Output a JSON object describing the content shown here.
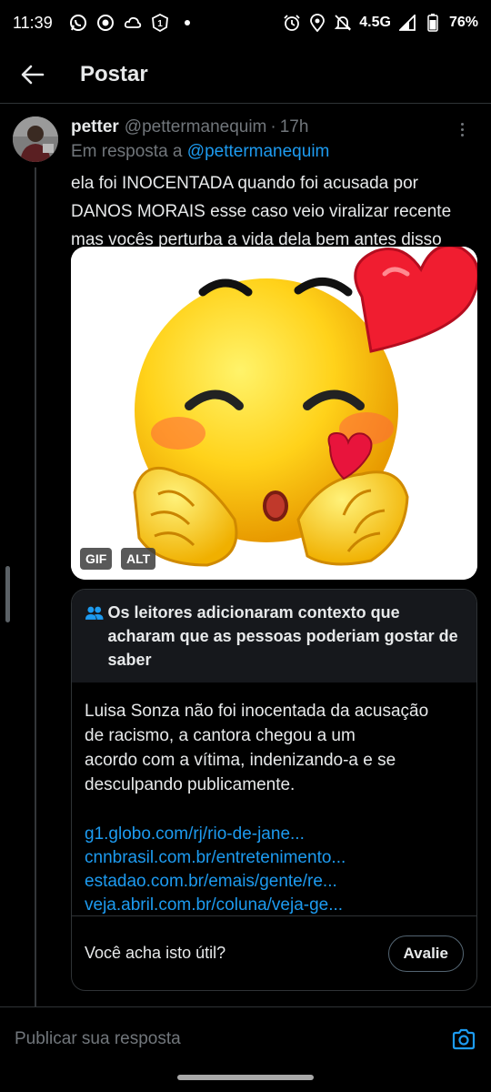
{
  "status_bar": {
    "time": "11:39",
    "network": "4.5G",
    "battery": "76%",
    "left_icons": [
      "whatsapp-icon",
      "record-icon",
      "cloud-icon",
      "sim-badge-icon",
      "dot-icon"
    ],
    "right_icons": [
      "alarm-icon",
      "location-icon",
      "bell-off-icon",
      "signal-icon",
      "battery-icon"
    ]
  },
  "header": {
    "title": "Postar"
  },
  "tweet": {
    "name": "petter",
    "handle": "@pettermanequim",
    "separator": "·",
    "time_ago": "17h",
    "reply_prefix": "Em resposta a",
    "reply_mention": "@pettermanequim",
    "text_lines": [
      "ela foi INOCENTADA quando foi acusada por",
      "DANOS MORAIS esse caso veio viralizar recente",
      "mas vocês perturba a vida dela bem antes disso"
    ],
    "media": {
      "badges": [
        "GIF",
        "ALT"
      ]
    }
  },
  "community_note": {
    "title": "Os leitores adicionaram contexto que acharam que as pessoas poderiam gostar de saber",
    "body_lines": [
      "Luisa Sonza não foi inocentada da acusação",
      "de racismo, a cantora chegou a um",
      "acordo com a vítima, indenizando-a e se",
      "desculpando publicamente."
    ],
    "links": [
      "g1.globo.com/rj/rio-de-jane...",
      "cnnbrasil.com.br/entretenimento...",
      "estadao.com.br/emais/gente/re...",
      "veja.abril.com.br/coluna/veja-ge..."
    ],
    "question": "Você acha isto útil?",
    "rate_label": "Avalie"
  },
  "reply_bar": {
    "placeholder": "Publicar sua resposta"
  },
  "colors": {
    "background": "#000000",
    "accent": "#1d9bf0",
    "muted": "#71767b",
    "border": "#2f3336"
  }
}
